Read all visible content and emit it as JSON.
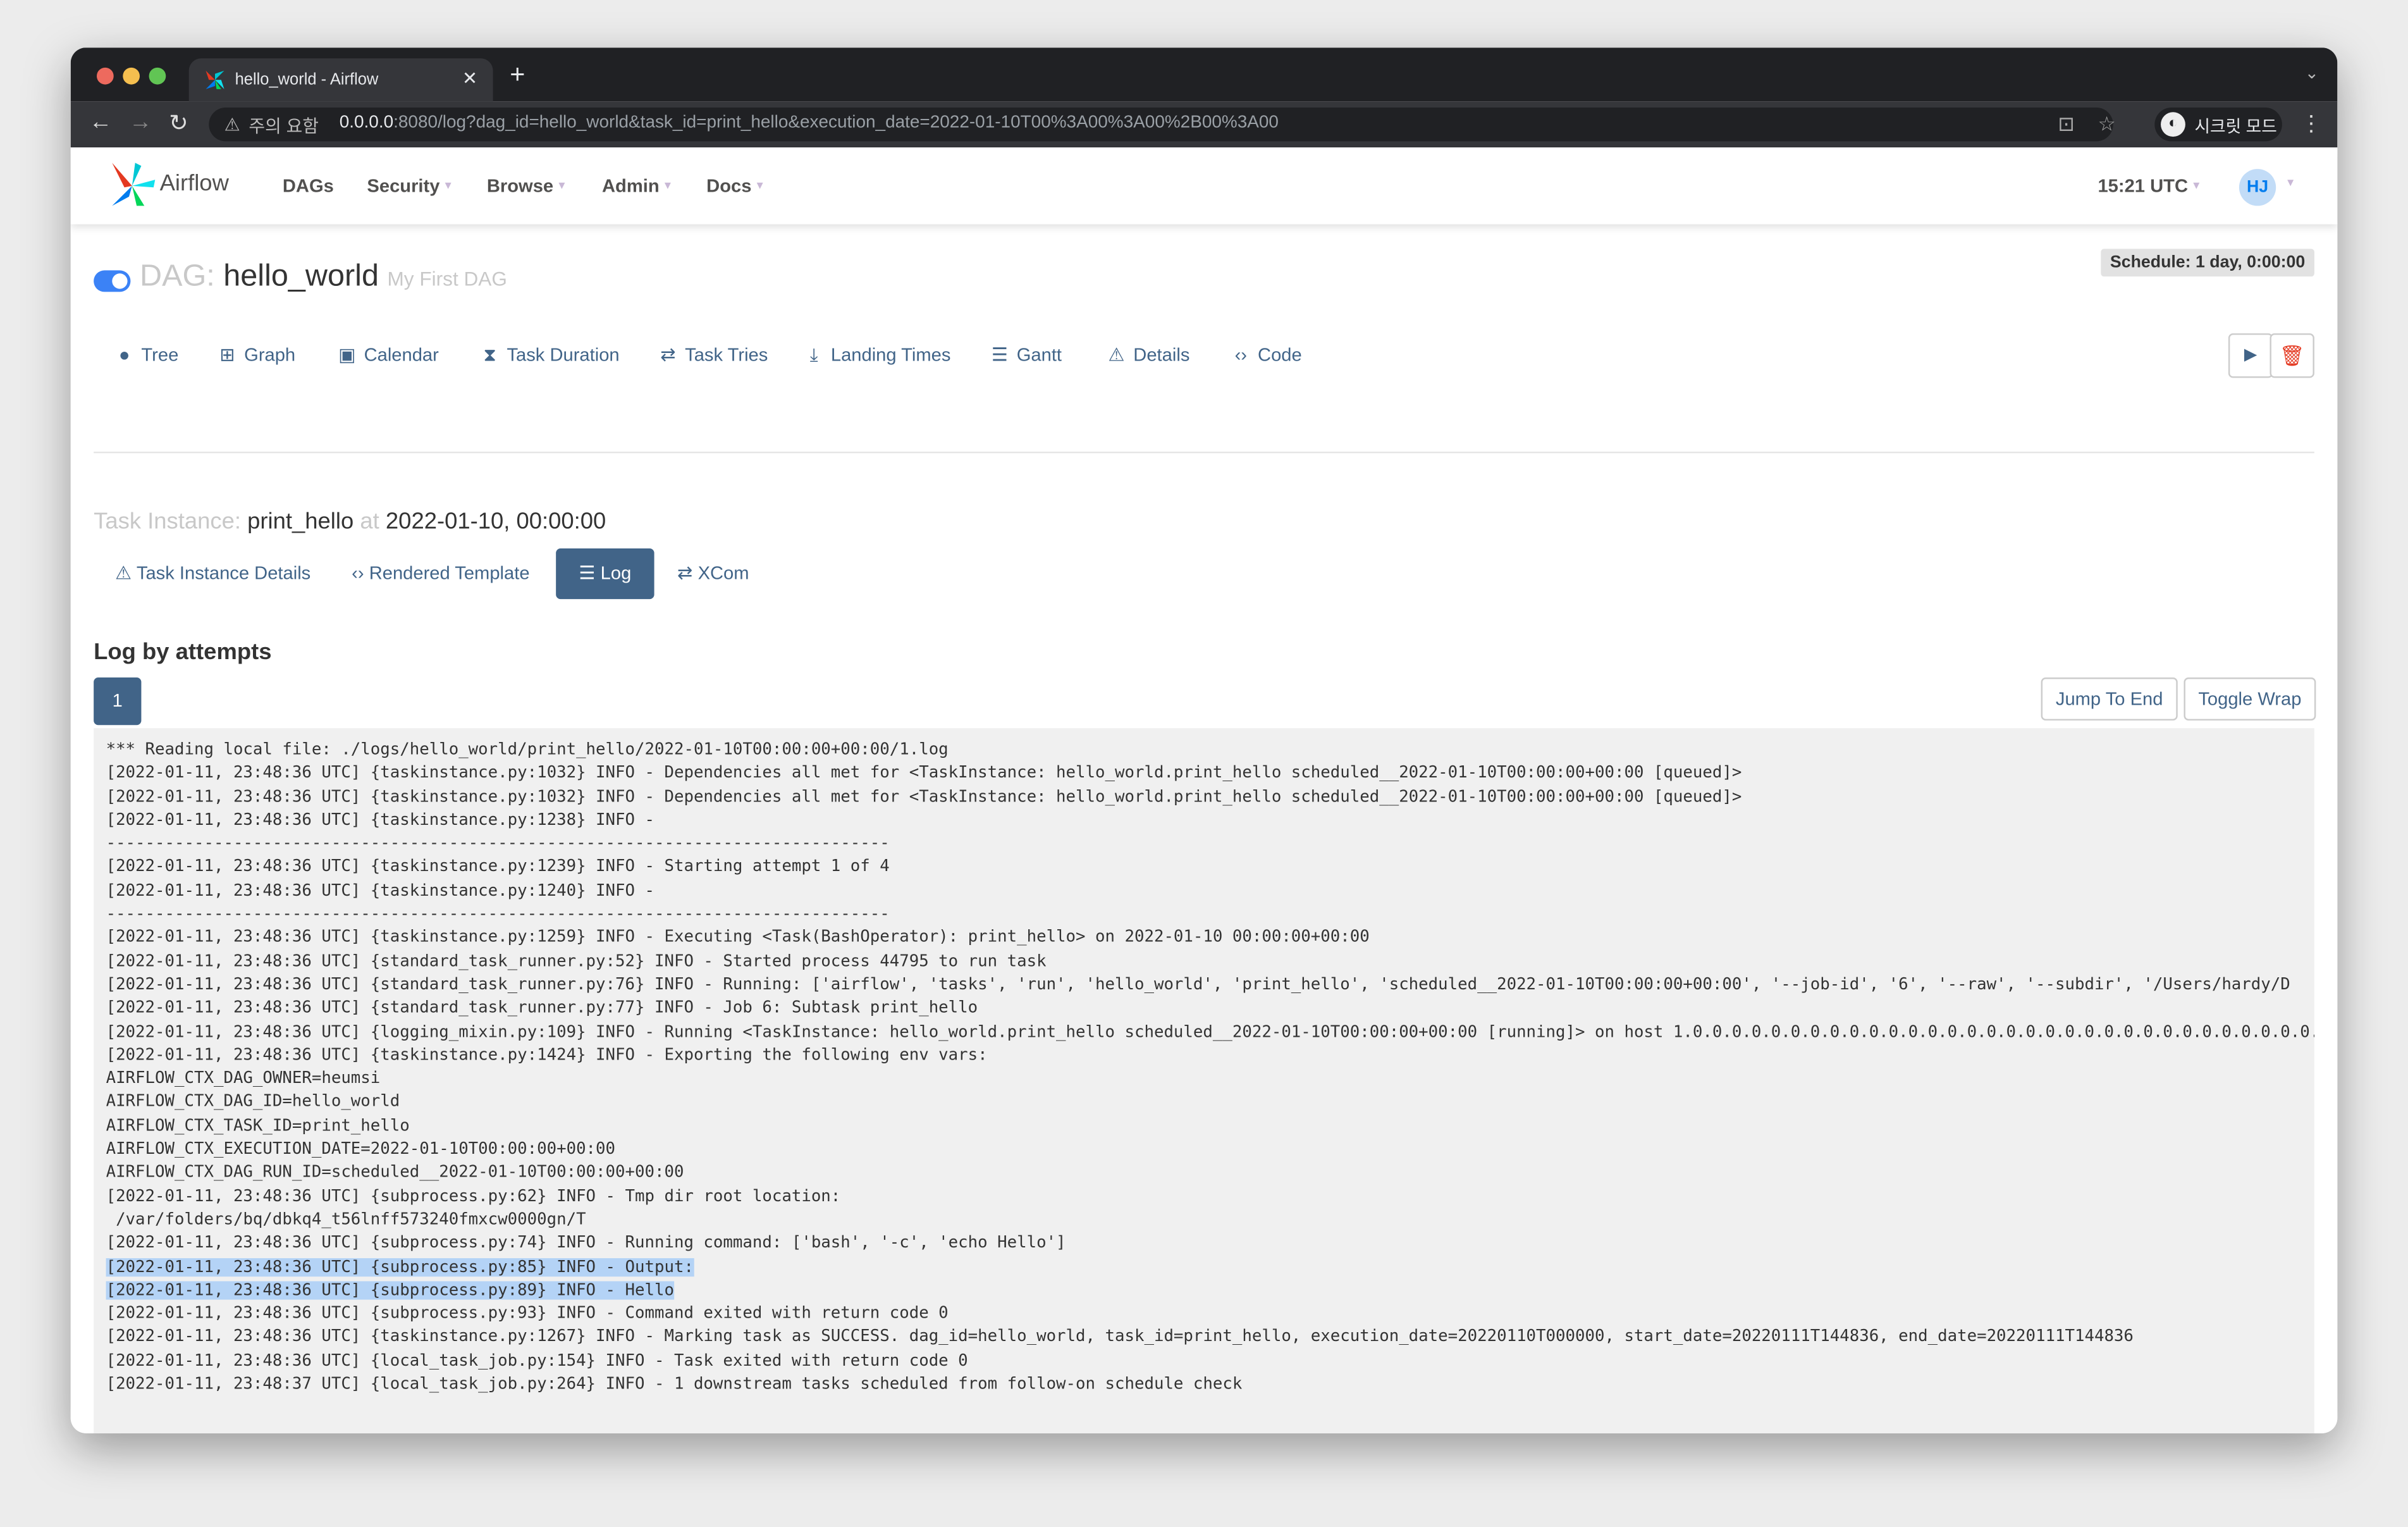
{
  "browser": {
    "tab_title": "hello_world - Airflow",
    "warning": "주의 요함",
    "url_host": "0.0.0.0",
    "url_rest": ":8080/log?dag_id=hello_world&task_id=print_hello&execution_date=2022-01-10T00%3A00%3A00%2B00%3A00",
    "incognito_label": "시크릿 모드"
  },
  "navbar": {
    "brand": "Airflow",
    "items": [
      "DAGs",
      "Security",
      "Browse",
      "Admin",
      "Docs"
    ],
    "clock": "15:21 UTC",
    "avatar": "HJ"
  },
  "dag": {
    "prefix": "DAG:",
    "id": "hello_world",
    "description": "My First DAG",
    "schedule": "Schedule: 1 day, 0:00:00",
    "paused": false
  },
  "dag_tabs": [
    {
      "label": "Tree",
      "icon": "tree-icon"
    },
    {
      "label": "Graph",
      "icon": "graph-icon"
    },
    {
      "label": "Calendar",
      "icon": "calendar-icon"
    },
    {
      "label": "Task Duration",
      "icon": "hourglass-icon"
    },
    {
      "label": "Task Tries",
      "icon": "retry-icon"
    },
    {
      "label": "Landing Times",
      "icon": "landing-icon"
    },
    {
      "label": "Gantt",
      "icon": "gantt-icon"
    },
    {
      "label": "Details",
      "icon": "details-icon"
    },
    {
      "label": "Code",
      "icon": "code-icon"
    }
  ],
  "task_instance": {
    "prefix": "Task Instance:",
    "task_id": "print_hello",
    "at": "at",
    "date": "2022-01-10, 00:00:00"
  },
  "ti_tabs": [
    {
      "label": "Task Instance Details"
    },
    {
      "label": "Rendered Template"
    },
    {
      "label": "Log",
      "active": true
    },
    {
      "label": "XCom"
    }
  ],
  "log": {
    "heading": "Log by attempts",
    "attempts": [
      "1"
    ],
    "jump_label": "Jump To End",
    "wrap_label": "Toggle Wrap",
    "lines": [
      "*** Reading local file: ./logs/hello_world/print_hello/2022-01-10T00:00:00+00:00/1.log",
      "[2022-01-11, 23:48:36 UTC] {taskinstance.py:1032} INFO - Dependencies all met for <TaskInstance: hello_world.print_hello scheduled__2022-01-10T00:00:00+00:00 [queued]>",
      "[2022-01-11, 23:48:36 UTC] {taskinstance.py:1032} INFO - Dependencies all met for <TaskInstance: hello_world.print_hello scheduled__2022-01-10T00:00:00+00:00 [queued]>",
      "[2022-01-11, 23:48:36 UTC] {taskinstance.py:1238} INFO - ",
      "--------------------------------------------------------------------------------",
      "[2022-01-11, 23:48:36 UTC] {taskinstance.py:1239} INFO - Starting attempt 1 of 4",
      "[2022-01-11, 23:48:36 UTC] {taskinstance.py:1240} INFO - ",
      "--------------------------------------------------------------------------------",
      "[2022-01-11, 23:48:36 UTC] {taskinstance.py:1259} INFO - Executing <Task(BashOperator): print_hello> on 2022-01-10 00:00:00+00:00",
      "[2022-01-11, 23:48:36 UTC] {standard_task_runner.py:52} INFO - Started process 44795 to run task",
      "[2022-01-11, 23:48:36 UTC] {standard_task_runner.py:76} INFO - Running: ['airflow', 'tasks', 'run', 'hello_world', 'print_hello', 'scheduled__2022-01-10T00:00:00+00:00', '--job-id', '6', '--raw', '--subdir', '/Users/hardy/D",
      "[2022-01-11, 23:48:36 UTC] {standard_task_runner.py:77} INFO - Job 6: Subtask print_hello",
      "[2022-01-11, 23:48:36 UTC] {logging_mixin.py:109} INFO - Running <TaskInstance: hello_world.print_hello scheduled__2022-01-10T00:00:00+00:00 [running]> on host 1.0.0.0.0.0.0.0.0.0.0.0.0.0.0.0.0.0.0.0.0.0.0.0.0.0.0.0.0.0.0.0.0.0",
      "[2022-01-11, 23:48:36 UTC] {taskinstance.py:1424} INFO - Exporting the following env vars:",
      "AIRFLOW_CTX_DAG_OWNER=heumsi",
      "AIRFLOW_CTX_DAG_ID=hello_world",
      "AIRFLOW_CTX_TASK_ID=print_hello",
      "AIRFLOW_CTX_EXECUTION_DATE=2022-01-10T00:00:00+00:00",
      "AIRFLOW_CTX_DAG_RUN_ID=scheduled__2022-01-10T00:00:00+00:00",
      "[2022-01-11, 23:48:36 UTC] {subprocess.py:62} INFO - Tmp dir root location:",
      " /var/folders/bq/dbkq4_t56lnff573240fmxcw0000gn/T",
      "[2022-01-11, 23:48:36 UTC] {subprocess.py:74} INFO - Running command: ['bash', '-c', 'echo Hello']",
      "[2022-01-11, 23:48:36 UTC] {subprocess.py:85} INFO - Output:",
      "[2022-01-11, 23:48:36 UTC] {subprocess.py:89} INFO - Hello",
      "[2022-01-11, 23:48:36 UTC] {subprocess.py:93} INFO - Command exited with return code 0",
      "[2022-01-11, 23:48:36 UTC] {taskinstance.py:1267} INFO - Marking task as SUCCESS. dag_id=hello_world, task_id=print_hello, execution_date=20220110T000000, start_date=20220111T144836, end_date=20220111T144836",
      "[2022-01-11, 23:48:36 UTC] {local_task_job.py:154} INFO - Task exited with return code 0",
      "[2022-01-11, 23:48:37 UTC] {local_task_job.py:264} INFO - 1 downstream tasks scheduled from follow-on schedule check"
    ],
    "highlighted_lines": [
      22,
      23
    ]
  },
  "colors": {
    "primary": "#416488",
    "toggle": "#3b82f6",
    "selection": "#b4d3f6"
  }
}
